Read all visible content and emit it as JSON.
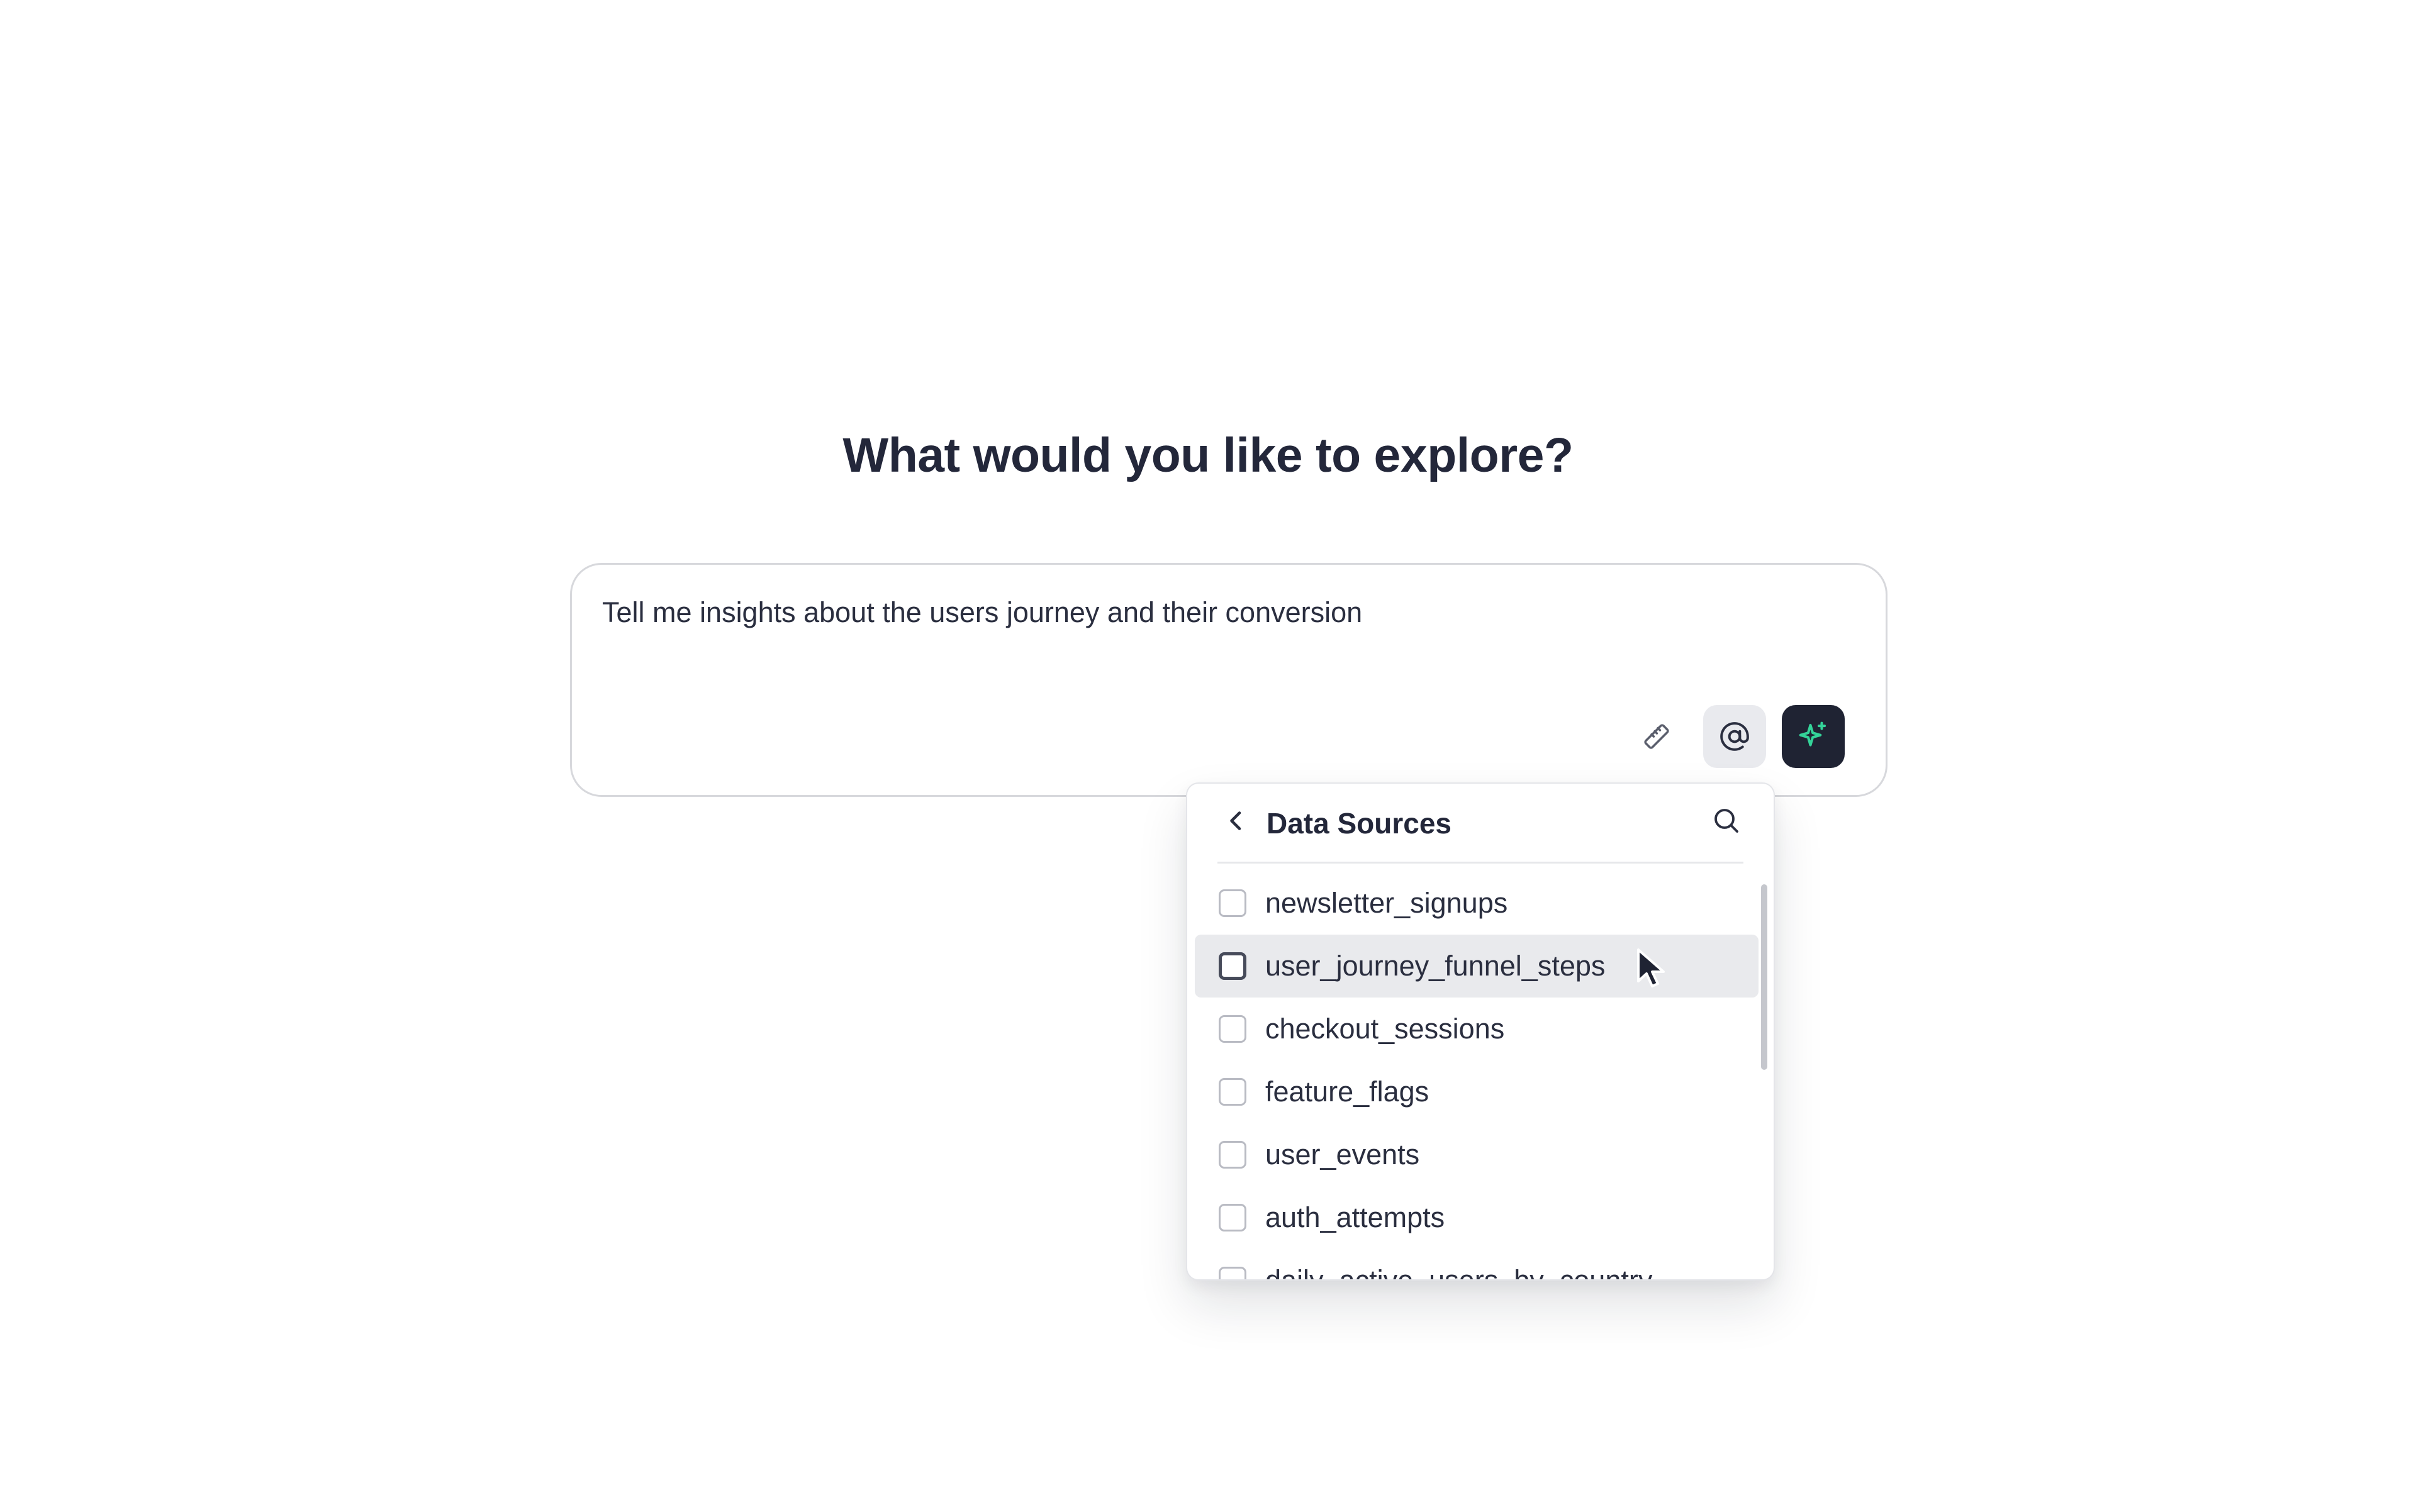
{
  "heading": "What would you like to explore?",
  "prompt": {
    "text": "Tell me insights about the users journey and their conversion",
    "tools": [
      {
        "icon": "ruler-icon"
      },
      {
        "icon": "at-sign-icon"
      },
      {
        "icon": "sparkles-icon"
      }
    ]
  },
  "dropdown": {
    "title": "Data Sources",
    "items": [
      {
        "label": "newsletter_signups",
        "checked": false
      },
      {
        "label": "user_journey_funnel_steps",
        "checked": false,
        "hovered": true
      },
      {
        "label": "checkout_sessions",
        "checked": false
      },
      {
        "label": "feature_flags",
        "checked": false
      },
      {
        "label": "user_events",
        "checked": false
      },
      {
        "label": "auth_attempts",
        "checked": false
      },
      {
        "label": "daily_active_users_by_country",
        "checked": false
      }
    ]
  },
  "colors": {
    "text": "#23273a",
    "submit_bg": "#1f2333",
    "sparkle": "#34d399",
    "hover_row": "#e9eaed"
  }
}
